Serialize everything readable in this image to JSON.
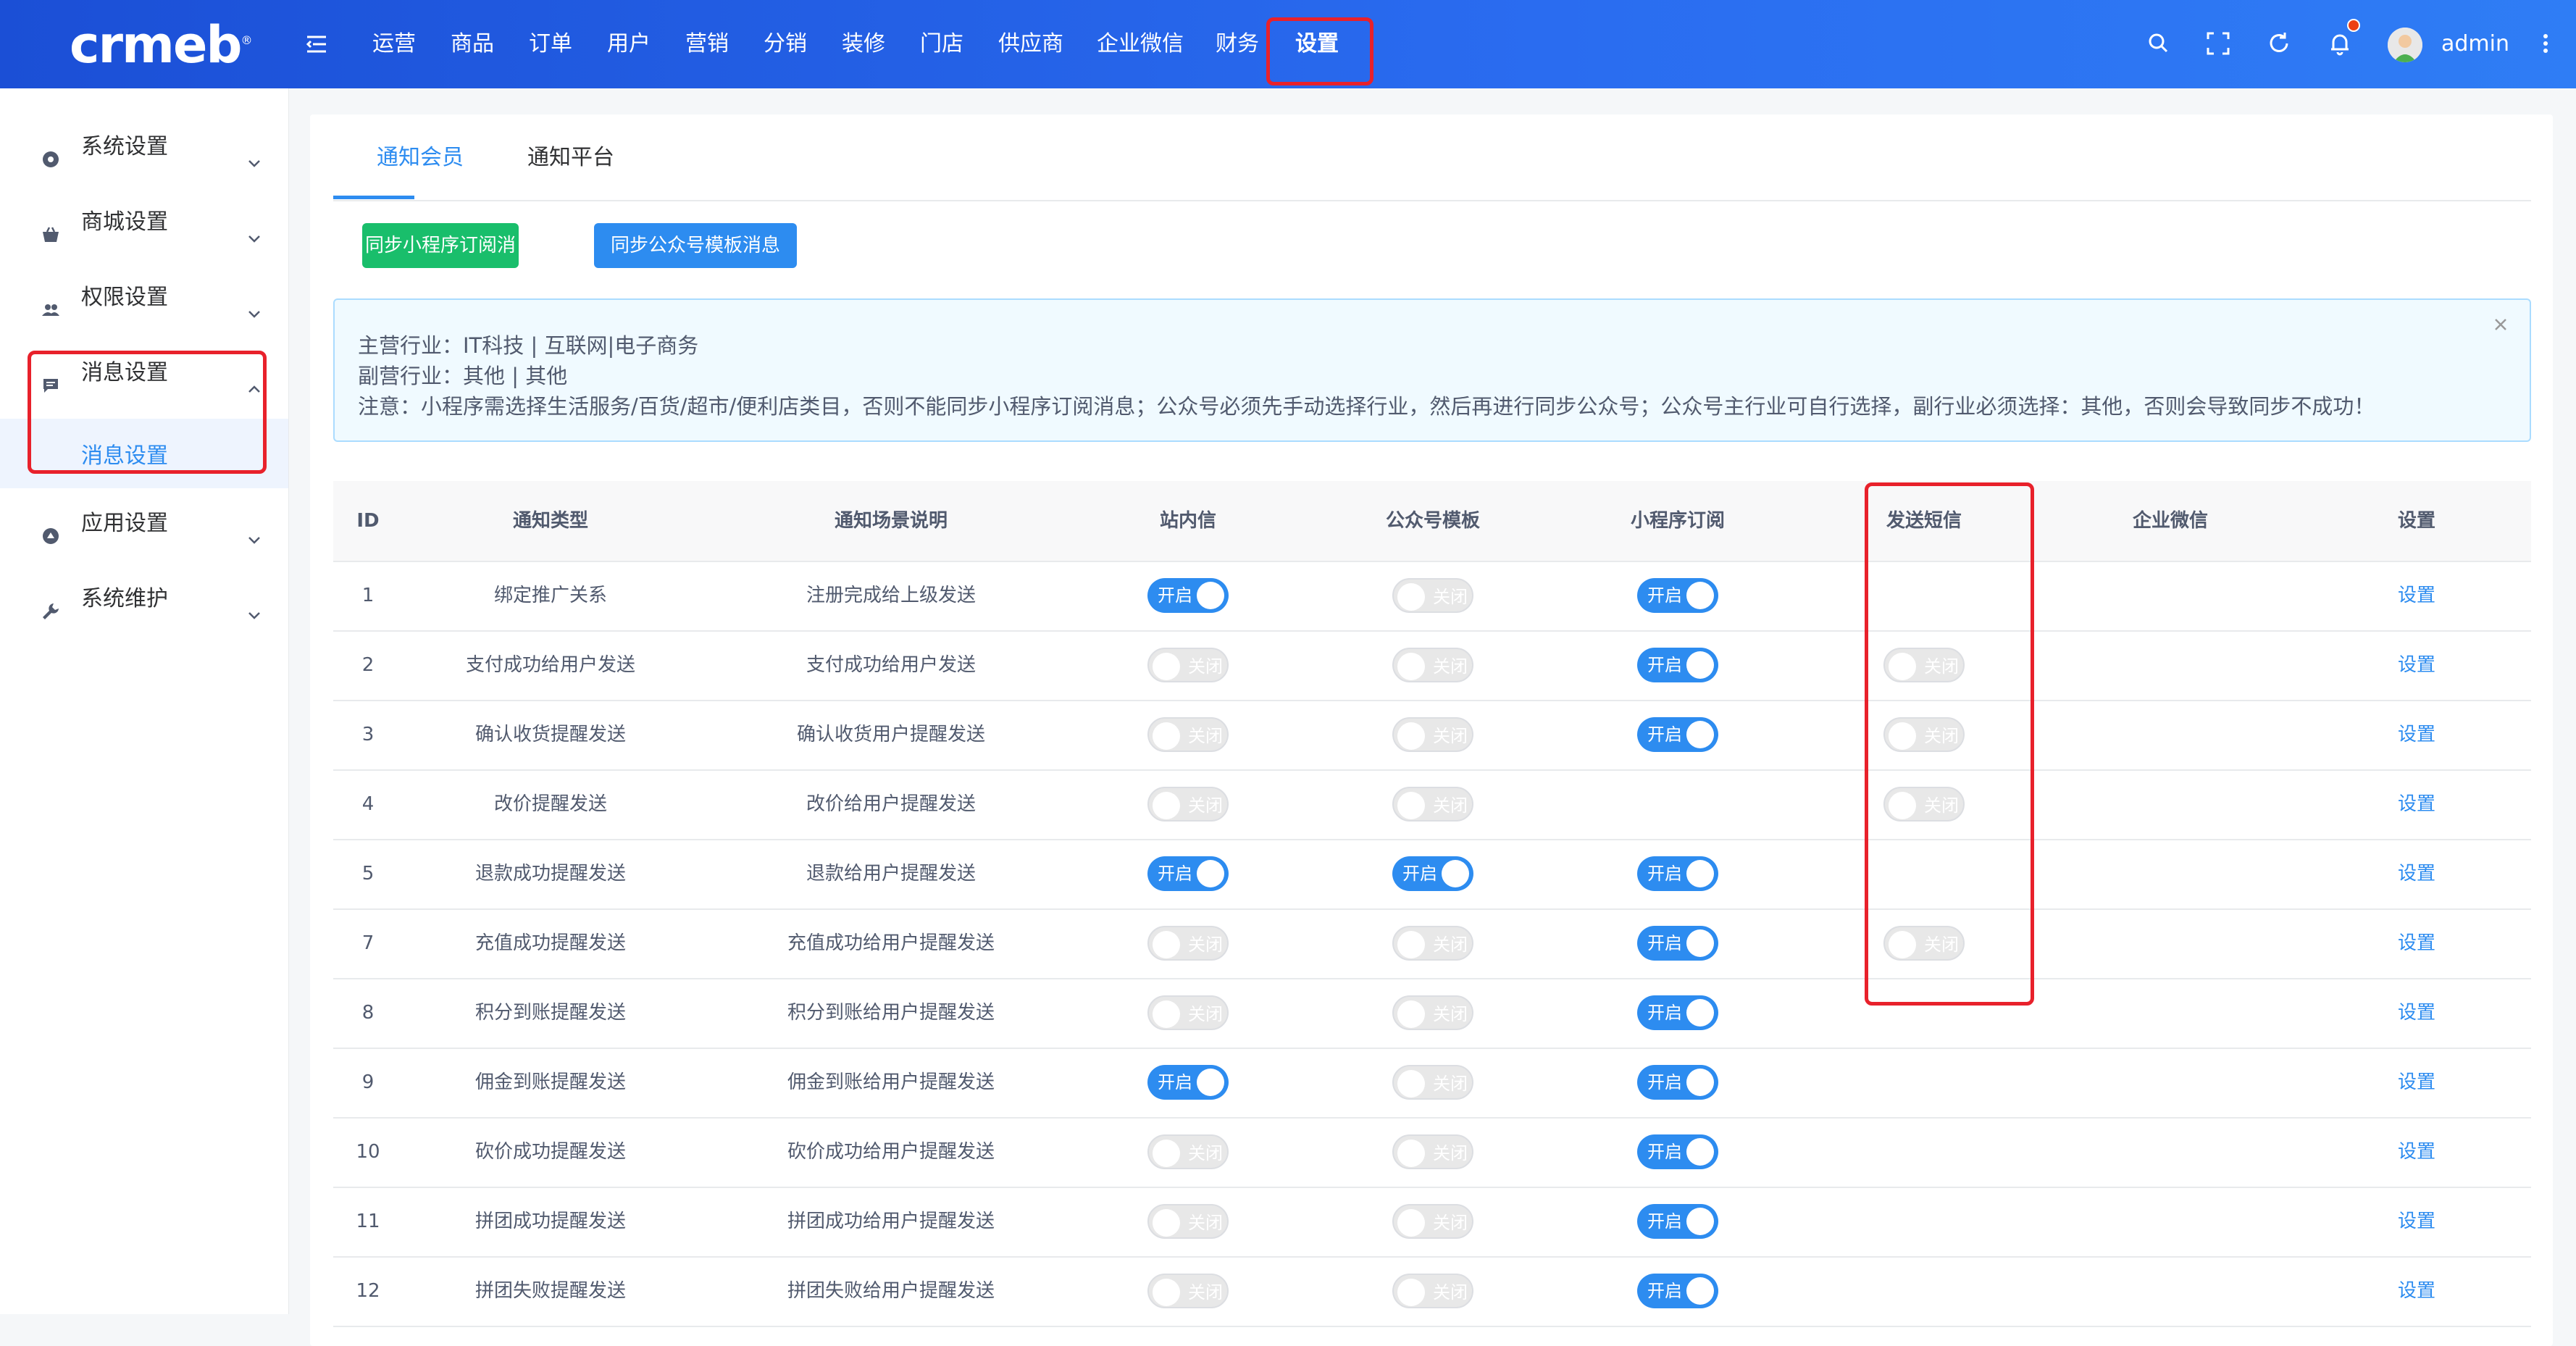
{
  "brand": {
    "logo_text": "crmeb",
    "logo_reg": "®"
  },
  "header": {
    "nav": [
      "运营",
      "商品",
      "订单",
      "用户",
      "营销",
      "分销",
      "装修",
      "门店",
      "供应商",
      "企业微信",
      "财务",
      "设置"
    ],
    "active_nav": "设置",
    "user": "admin",
    "icons": [
      "search-icon",
      "fullscreen-icon",
      "refresh-icon",
      "bell-icon",
      "avatar",
      "more-vertical-icon"
    ]
  },
  "sidebar": {
    "items": [
      {
        "label": "系统设置",
        "icon": "system-settings-icon"
      },
      {
        "label": "商城设置",
        "icon": "shop-icon"
      },
      {
        "label": "权限设置",
        "icon": "users-icon"
      },
      {
        "label": "消息设置",
        "icon": "message-icon"
      },
      {
        "label": "应用设置",
        "icon": "app-icon"
      },
      {
        "label": "系统维护",
        "icon": "wrench-icon"
      }
    ],
    "active_sub": "消息设置"
  },
  "tabs": [
    "通知会员",
    "通知平台"
  ],
  "buttons": {
    "sync_miniprogram": "同步小程序订阅消息",
    "sync_official": "同步公众号模板消息"
  },
  "alert": {
    "line1": "主营行业：IT科技 | 互联网|电子商务",
    "line2": "副营行业：其他 | 其他",
    "line3": "注意：小程序需选择生活服务/百货/超市/便利店类目，否则不能同步小程序订阅消息；公众号必须先手动选择行业，然后再进行同步公众号；公众号主行业可自行选择，副行业必须选择：其他，否则会导致同步不成功！"
  },
  "table": {
    "headers": [
      "ID",
      "通知类型",
      "通知场景说明",
      "站内信",
      "公众号模板",
      "小程序订阅",
      "发送短信",
      "企业微信",
      "设置"
    ],
    "switch_on_label": "开启",
    "switch_off_label": "关闭",
    "action_label": "设置",
    "rows": [
      {
        "id": "1",
        "type": "绑定推广关系",
        "desc": "注册完成给上级发送",
        "site": "on",
        "official": "off",
        "mini": "on",
        "sms": null,
        "wework": null
      },
      {
        "id": "2",
        "type": "支付成功给用户发送",
        "desc": "支付成功给用户发送",
        "site": "off",
        "official": "off",
        "mini": "on",
        "sms": "off",
        "wework": null
      },
      {
        "id": "3",
        "type": "确认收货提醒发送",
        "desc": "确认收货用户提醒发送",
        "site": "off",
        "official": "off",
        "mini": "on",
        "sms": "off",
        "wework": null
      },
      {
        "id": "4",
        "type": "改价提醒发送",
        "desc": "改价给用户提醒发送",
        "site": "off",
        "official": "off",
        "mini": null,
        "sms": "off",
        "wework": null
      },
      {
        "id": "5",
        "type": "退款成功提醒发送",
        "desc": "退款给用户提醒发送",
        "site": "on",
        "official": "on",
        "mini": "on",
        "sms": null,
        "wework": null
      },
      {
        "id": "7",
        "type": "充值成功提醒发送",
        "desc": "充值成功给用户提醒发送",
        "site": "off",
        "official": "off",
        "mini": "on",
        "sms": "off",
        "wework": null
      },
      {
        "id": "8",
        "type": "积分到账提醒发送",
        "desc": "积分到账给用户提醒发送",
        "site": "off",
        "official": "off",
        "mini": "on",
        "sms": null,
        "wework": null
      },
      {
        "id": "9",
        "type": "佣金到账提醒发送",
        "desc": "佣金到账给用户提醒发送",
        "site": "on",
        "official": "off",
        "mini": "on",
        "sms": null,
        "wework": null
      },
      {
        "id": "10",
        "type": "砍价成功提醒发送",
        "desc": "砍价成功给用户提醒发送",
        "site": "off",
        "official": "off",
        "mini": "on",
        "sms": null,
        "wework": null
      },
      {
        "id": "11",
        "type": "拼团成功提醒发送",
        "desc": "拼团成功给用户提醒发送",
        "site": "off",
        "official": "off",
        "mini": "on",
        "sms": null,
        "wework": null
      },
      {
        "id": "12",
        "type": "拼团失败提醒发送",
        "desc": "拼团失败给用户提醒发送",
        "site": "off",
        "official": "off",
        "mini": "on",
        "sms": null,
        "wework": null
      }
    ]
  },
  "colors": {
    "primary": "#2d8cf0",
    "success": "#19be6b",
    "highlight": "#e8212b",
    "header_start": "#1b4fd6",
    "header_end": "#2f7df5"
  }
}
